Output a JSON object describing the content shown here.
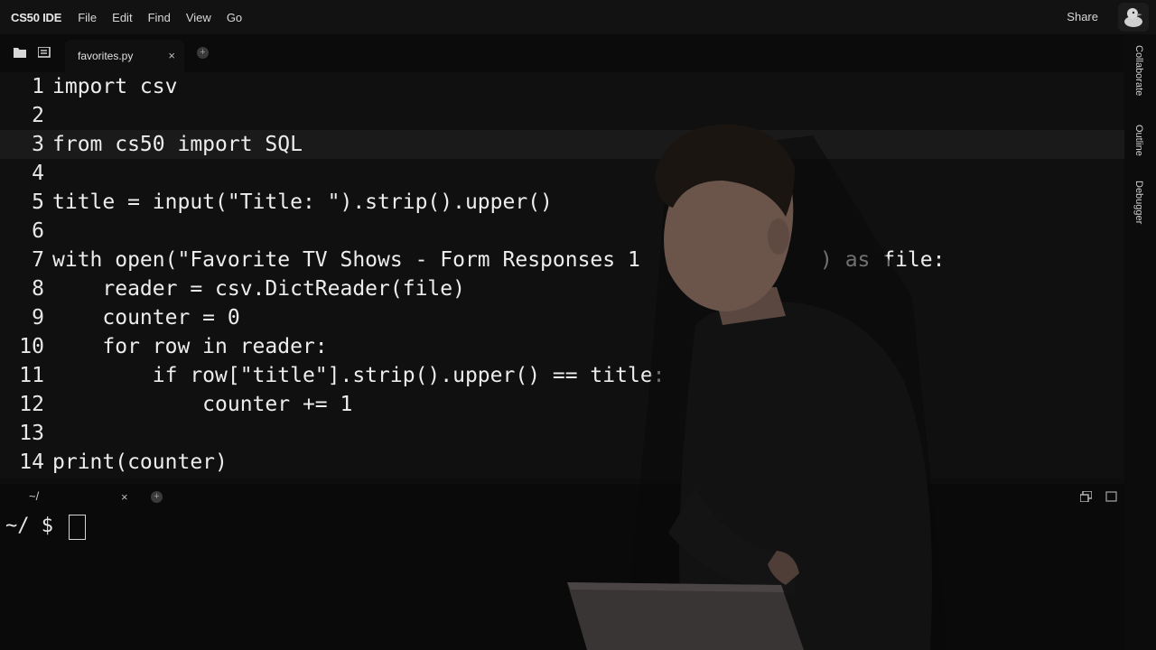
{
  "menubar": {
    "brand": "CS50 IDE",
    "items": [
      "File",
      "Edit",
      "Find",
      "View",
      "Go"
    ],
    "share": "Share"
  },
  "tabs": [
    {
      "label": "favorites.py",
      "close": "×"
    }
  ],
  "add_tab": "+",
  "right_rail": [
    "Collaborate",
    "Outline",
    "Debugger"
  ],
  "editor": {
    "active_line": 3,
    "lines": [
      {
        "num": "1",
        "text": "import csv"
      },
      {
        "num": "2",
        "text": ""
      },
      {
        "num": "3",
        "text": "from cs50 import SQL"
      },
      {
        "num": "4",
        "text": ""
      },
      {
        "num": "5",
        "text": "title = input(\"Title: \").strip().upper()"
      },
      {
        "num": "6",
        "text": ""
      },
      {
        "num": "7",
        "text": "with open(\"Favorite TV Shows - Form Responses 1"
      },
      {
        "num": "8",
        "text": "    reader = csv.DictReader(file)"
      },
      {
        "num": "9",
        "text": "    counter = 0"
      },
      {
        "num": "10",
        "text": "    for row in reader:"
      },
      {
        "num": "11",
        "text": "        if row[\"title\"].strip().upper() == title:"
      },
      {
        "num": "12",
        "text": "            counter += 1"
      },
      {
        "num": "13",
        "text": ""
      },
      {
        "num": "14",
        "text": "print(counter)"
      }
    ],
    "line7_tail": ") as file:"
  },
  "terminal": {
    "tab_label": "~/",
    "tab_close": "×",
    "add_tab": "+",
    "prompt": "~/ $ "
  },
  "colors": {
    "background": "#0e0e0e",
    "editor_bg": "#101010",
    "active_line": "#1a1a1a",
    "text": "#ededed"
  }
}
